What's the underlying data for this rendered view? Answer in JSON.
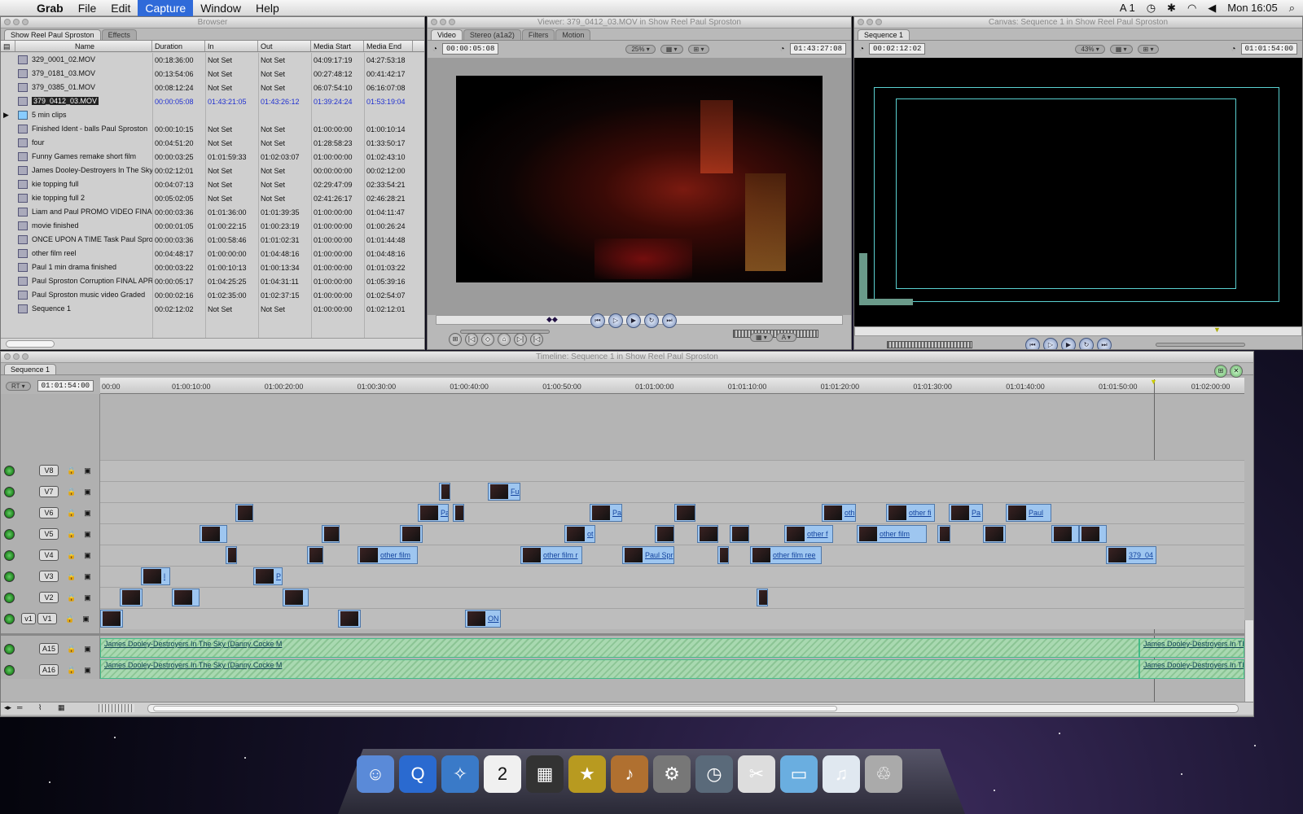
{
  "menubar": {
    "app": "Grab",
    "items": [
      "File",
      "Edit",
      "Capture",
      "Window",
      "Help"
    ],
    "selected": "Capture",
    "status_a": "1",
    "clock": "Mon 16:05"
  },
  "browser": {
    "title": "Browser",
    "tabs": [
      "Show Reel Paul Sproston",
      "Effects"
    ],
    "columns": [
      "Name",
      "Duration",
      "In",
      "Out",
      "Media Start",
      "Media End"
    ],
    "rows": [
      {
        "name": "329_0001_02.MOV",
        "dur": "00:18:36:00",
        "in": "Not Set",
        "out": "Not Set",
        "ms": "04:09:17:19",
        "me": "04:27:53:18"
      },
      {
        "name": "379_0181_03.MOV",
        "dur": "00:13:54:06",
        "in": "Not Set",
        "out": "Not Set",
        "ms": "00:27:48:12",
        "me": "00:41:42:17"
      },
      {
        "name": "379_0385_01.MOV",
        "dur": "00:08:12:24",
        "in": "Not Set",
        "out": "Not Set",
        "ms": "06:07:54:10",
        "me": "06:16:07:08"
      },
      {
        "name": "379_0412_03.MOV",
        "dur": "00:00:05:08",
        "in": "01:43:21:05",
        "out": "01:43:26:12",
        "ms": "01:39:24:24",
        "me": "01:53:19:04"
      },
      {
        "name": "5 min clips",
        "dur": "",
        "in": "",
        "out": "",
        "ms": "",
        "me": ""
      },
      {
        "name": "Finished Ident - balls Paul Sproston",
        "dur": "00:00:10:15",
        "in": "Not Set",
        "out": "Not Set",
        "ms": "01:00:00:00",
        "me": "01:00:10:14"
      },
      {
        "name": "four",
        "dur": "00:04:51:20",
        "in": "Not Set",
        "out": "Not Set",
        "ms": "01:28:58:23",
        "me": "01:33:50:17"
      },
      {
        "name": "Funny Games remake short film",
        "dur": "00:00:03:25",
        "in": "01:01:59:33",
        "out": "01:02:03:07",
        "ms": "01:00:00:00",
        "me": "01:02:43:10"
      },
      {
        "name": "James Dooley-Destroyers In The Sky",
        "dur": "00:02:12:01",
        "in": "Not Set",
        "out": "Not Set",
        "ms": "00:00:00:00",
        "me": "00:02:12:00"
      },
      {
        "name": "kie topping full",
        "dur": "00:04:07:13",
        "in": "Not Set",
        "out": "Not Set",
        "ms": "02:29:47:09",
        "me": "02:33:54:21"
      },
      {
        "name": "kie topping full 2",
        "dur": "00:05:02:05",
        "in": "Not Set",
        "out": "Not Set",
        "ms": "02:41:26:17",
        "me": "02:46:28:21"
      },
      {
        "name": "Liam and Paul PROMO VIDEO FINAL",
        "dur": "00:00:03:36",
        "in": "01:01:36:00",
        "out": "01:01:39:35",
        "ms": "01:00:00:00",
        "me": "01:04:11:47"
      },
      {
        "name": "movie finished",
        "dur": "00:00:01:05",
        "in": "01:00:22:15",
        "out": "01:00:23:19",
        "ms": "01:00:00:00",
        "me": "01:00:26:24"
      },
      {
        "name": "ONCE UPON A TIME Task Paul Sproston",
        "dur": "00:00:03:36",
        "in": "01:00:58:46",
        "out": "01:01:02:31",
        "ms": "01:00:00:00",
        "me": "01:01:44:48"
      },
      {
        "name": "other film reel",
        "dur": "00:04:48:17",
        "in": "01:00:00:00",
        "out": "01:04:48:16",
        "ms": "01:00:00:00",
        "me": "01:04:48:16"
      },
      {
        "name": "Paul 1 min drama finished",
        "dur": "00:00:03:22",
        "in": "01:00:10:13",
        "out": "01:00:13:34",
        "ms": "01:00:00:00",
        "me": "01:01:03:22"
      },
      {
        "name": "Paul Sproston Corruption FINAL APR",
        "dur": "00:00:05:17",
        "in": "01:04:25:25",
        "out": "01:04:31:11",
        "ms": "01:00:00:00",
        "me": "01:05:39:16"
      },
      {
        "name": "Paul Sproston music video Graded",
        "dur": "00:00:02:16",
        "in": "01:02:35:00",
        "out": "01:02:37:15",
        "ms": "01:00:00:00",
        "me": "01:02:54:07"
      },
      {
        "name": "Sequence 1",
        "dur": "00:02:12:02",
        "in": "Not Set",
        "out": "Not Set",
        "ms": "01:00:00:00",
        "me": "01:02:12:01"
      }
    ]
  },
  "viewer": {
    "title": "Viewer: 379_0412_03.MOV in Show Reel Paul Sproston",
    "tabs": [
      "Video",
      "Stereo (a1a2)",
      "Filters",
      "Motion"
    ],
    "tc_left": "00:00:05:08",
    "tc_right": "01:43:27:08",
    "zoom": "25%"
  },
  "canvas": {
    "title": "Canvas: Sequence 1 in Show Reel Paul Sproston",
    "tab": "Sequence 1",
    "tc_left": "00:02:12:02",
    "tc_right": "01:01:54:00",
    "zoom": "43%"
  },
  "timeline": {
    "title": "Timeline: Sequence 1 in Show Reel Paul Sproston",
    "tab": "Sequence 1",
    "rt": "RT",
    "timecode": "01:01:54:00",
    "ruler": [
      "00:00",
      "01:00:10:00",
      "01:00:20:00",
      "01:00:30:00",
      "01:00:40:00",
      "01:00:50:00",
      "01:01:00:00",
      "01:01:10:00",
      "01:01:20:00",
      "01:01:30:00",
      "01:01:40:00",
      "01:01:50:00",
      "01:02:00:00"
    ],
    "video_tracks": [
      "V8",
      "V7",
      "V6",
      "V5",
      "V4",
      "V3",
      "V2",
      "V1"
    ],
    "v1_patch": "v1",
    "clip_labels": {
      "c1": "Fu",
      "c2": "Pa",
      "c3": "Pa",
      "c4": "oth",
      "c5": "other fi",
      "c6": "Pa",
      "c7": "Paul",
      "c8": "ot",
      "c9": "other f",
      "c10": "other film",
      "c11": "O",
      "c12": "other film",
      "c13": "other film r",
      "c14": "Paul Spr",
      "c15": "co",
      "c16": "other film ree",
      "c17": "379_04",
      "c18": "l",
      "c19": "P",
      "c20": "m",
      "c21": "ON"
    },
    "audio_tracks": [
      "A15",
      "A16"
    ],
    "audio_clip": "James Dooley-Destroyers In The Sky (Danny Cocke M",
    "audio_clip_end": "James Dooley-Destroyers In The"
  },
  "dock": [
    "finder-icon",
    "quicktime-icon",
    "safari-icon",
    "ical-icon",
    "clapper-icon",
    "imovie-icon",
    "garageband-icon",
    "preferences-icon",
    "time-machine-icon",
    "scissors-icon",
    "folder-icon",
    "mp3-icon",
    "trash-icon"
  ],
  "dock_ical_day": "2"
}
